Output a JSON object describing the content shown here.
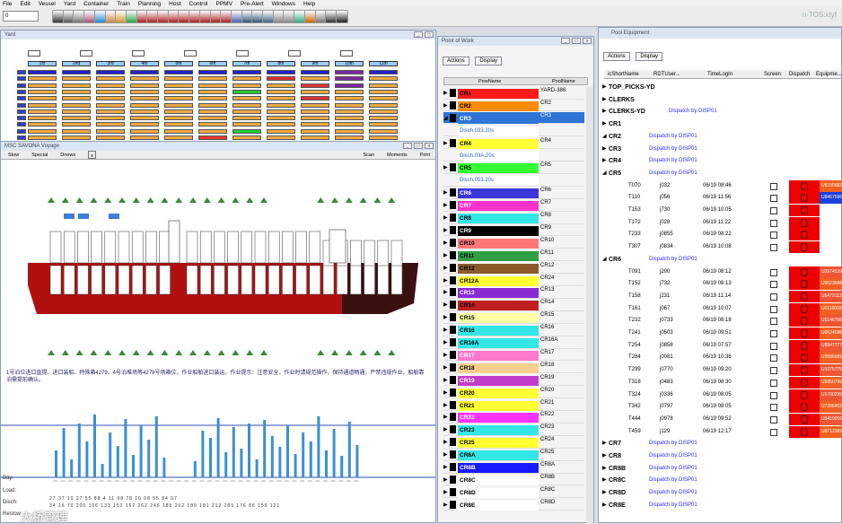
{
  "menu": [
    "File",
    "Edit",
    "Vessel",
    "Yard",
    "Container",
    "Train",
    "Planning",
    "Host",
    "Control",
    "PPMV",
    "Pre-Alert",
    "Windows",
    "Help"
  ],
  "toolbar": {
    "combo_value": "0",
    "app_title": "n-TOS:xtyf"
  },
  "yard": {
    "title": "Yard",
    "blocks": [
      "1st",
      "2nd",
      "3rd",
      "4th",
      "5th",
      "6th",
      "7th",
      "8th",
      "9th",
      "10th",
      "11th"
    ]
  },
  "vessel": {
    "title": "MSC SAVONA  Voyage",
    "tabs": [
      "Stow",
      "Special",
      "Dnews"
    ],
    "right_tabs": [
      "Scan",
      "Moments",
      "Print"
    ],
    "note": "1号泊位进口直提、进口装船、特殊箱4279、4号泊堆场等4279号场箱位，作业船舶进口装运。作业提示：注意安全，作业时请规范操作，保持通道畅通，严禁违规作业，船舶靠泊需提前确认。",
    "row_labels": [
      "Bay:",
      "Load:",
      "Disch:",
      "Restow:"
    ],
    "load_nums": "27 37 10 27 55 88 4 11 98 78 16 08 55 84 07",
    "disch_nums": "34 16 70 200 106 133 152 162 262 246 186 262 189 181 212 289 176 86 159 121",
    "watermark": "大桥管理"
  },
  "pow": {
    "title": "Point of Work",
    "actions": "Actions",
    "display": "Display",
    "col_pow": "PowName",
    "col_pool": "PoolName",
    "rows": [
      {
        "name": "CR1",
        "color": "#ff1a1a",
        "pool": "YARD-386",
        "text": "#000"
      },
      {
        "name": "CR2",
        "color": "#ff8c00",
        "pool": "CR2",
        "text": "#000"
      },
      {
        "name": "CR3",
        "color": "#2f75d6",
        "pool": "CR3",
        "text": "#fff",
        "selected": true
      },
      {
        "name": "Disch.033.20s",
        "color": "#fff",
        "pool": "",
        "text": "#2a62c9",
        "sub": true
      },
      {
        "name": "CR4",
        "color": "#ffff33",
        "pool": "CR4",
        "text": "#000"
      },
      {
        "name": "Disch.03A.20s",
        "color": "#fff",
        "pool": "",
        "text": "#2a62c9",
        "sub": true
      },
      {
        "name": "CR5",
        "color": "#33ff33",
        "pool": "CR5",
        "text": "#000"
      },
      {
        "name": "Disch.053.20s",
        "color": "#fff",
        "pool": "",
        "text": "#2a62c9",
        "sub": true
      },
      {
        "name": "CR6",
        "color": "#3a37d8",
        "pool": "CR6",
        "text": "#fff"
      },
      {
        "name": "CR7",
        "color": "#ff33cc",
        "pool": "CR7",
        "text": "#fff"
      },
      {
        "name": "CR8",
        "color": "#33e6e6",
        "pool": "CR8",
        "text": "#000"
      },
      {
        "name": "CR9",
        "color": "#000000",
        "pool": "CR9",
        "text": "#fff"
      },
      {
        "name": "CR10",
        "color": "#ff7777",
        "pool": "CR10",
        "text": "#000"
      },
      {
        "name": "CR11",
        "color": "#2ea043",
        "pool": "CR11",
        "text": "#000"
      },
      {
        "name": "CR12",
        "color": "#8a5a2b",
        "pool": "CR12",
        "text": "#000"
      },
      {
        "name": "CR12A",
        "color": "#ffff33",
        "pool": "CR24",
        "text": "#000"
      },
      {
        "name": "CR13",
        "color": "#8a2bd6",
        "pool": "CR13",
        "text": "#fff"
      },
      {
        "name": "CR14",
        "color": "#c02020",
        "pool": "CR14",
        "text": "#000"
      },
      {
        "name": "CR15",
        "color": "#ffffa8",
        "pool": "CR15",
        "text": "#000"
      },
      {
        "name": "CR16",
        "color": "#33e6e6",
        "pool": "CR16",
        "text": "#000"
      },
      {
        "name": "CR16A",
        "color": "#33e6e6",
        "pool": "CR16A",
        "text": "#000"
      },
      {
        "name": "CR17",
        "color": "#ff77cc",
        "pool": "CR17",
        "text": "#fff"
      },
      {
        "name": "CR18",
        "color": "#f6d08c",
        "pool": "CR18",
        "text": "#000"
      },
      {
        "name": "CR19",
        "color": "#c33cc9",
        "pool": "CR19",
        "text": "#fff"
      },
      {
        "name": "CR20",
        "color": "#ffff33",
        "pool": "CR20",
        "text": "#000"
      },
      {
        "name": "CR21",
        "color": "#ffff33",
        "pool": "CR21",
        "text": "#000"
      },
      {
        "name": "CR22",
        "color": "#ff33ff",
        "pool": "CR22",
        "text": "#fff"
      },
      {
        "name": "CR23",
        "color": "#33e6e6",
        "pool": "CR23",
        "text": "#000"
      },
      {
        "name": "CR25",
        "color": "#ffff33",
        "pool": "CR24",
        "text": "#000"
      },
      {
        "name": "CR8A",
        "color": "#33e6e6",
        "pool": "CR25",
        "text": "#000"
      },
      {
        "name": "CR8B",
        "color": "#1a1aff",
        "pool": "CR8A",
        "text": "#fff"
      },
      {
        "name": "CR8C",
        "color": "#fff",
        "pool": "CR8B",
        "text": "#000"
      },
      {
        "name": "CR8D",
        "color": "#fff",
        "pool": "CR8C",
        "text": "#000"
      },
      {
        "name": "CR8E",
        "color": "#fff",
        "pool": "CR8D",
        "text": "#000"
      }
    ]
  },
  "pool": {
    "title": "Pool Equipment",
    "actions": "Actions",
    "display": "Display",
    "headers": [
      "icShortName",
      "RDTUser...",
      "TimeLogIn",
      "Screen",
      "Dispatch",
      "Equipme..."
    ],
    "dispatch_label": "Dispatch by DISP01",
    "rows": [
      {
        "t": "group",
        "name": "TOP_PICKS-YD"
      },
      {
        "t": "group",
        "name": "CLERKS"
      },
      {
        "t": "group",
        "name": "CLERKS-YD",
        "disp": true
      },
      {
        "t": "group",
        "name": "CR1"
      },
      {
        "t": "group",
        "name": "CR2",
        "disp": true,
        "open": true
      },
      {
        "t": "group",
        "name": "CR3",
        "disp": true
      },
      {
        "t": "group",
        "name": "CR4",
        "disp": true
      },
      {
        "t": "group",
        "name": "CR5",
        "disp": true,
        "open": true
      },
      {
        "t": "eq",
        "name": "T070",
        "user": "j032",
        "time": "06/19 08:46",
        "status": "U5155683"
      },
      {
        "t": "eq",
        "name": "T110",
        "user": "j056",
        "time": "06/19 11:56",
        "status": "U8467596"
      },
      {
        "t": "eq",
        "name": "T153",
        "user": "j730",
        "time": "06/19 10:05"
      },
      {
        "t": "eq",
        "name": "T172",
        "user": "j028",
        "time": "06/19 11:22"
      },
      {
        "t": "eq",
        "name": "T233",
        "user": "j0855",
        "time": "06/19 08:22"
      },
      {
        "t": "eq",
        "name": "T307",
        "user": "j0834",
        "time": "06/19 10:08"
      },
      {
        "t": "group",
        "name": "CR6",
        "disp": true,
        "open": true
      },
      {
        "t": "eq",
        "name": "T091",
        "user": "j200",
        "time": "06/19 08:12",
        "status": "U2974539"
      },
      {
        "t": "eq",
        "name": "T152",
        "user": "j732",
        "time": "06/19 08:13",
        "status": "U0023588"
      },
      {
        "t": "eq",
        "name": "T158",
        "user": "j231",
        "time": "06/19 11:14",
        "status": "U5479113"
      },
      {
        "t": "eq",
        "name": "T161",
        "user": "j067",
        "time": "06/19 10:07",
        "status": "U0110003"
      },
      {
        "t": "eq",
        "name": "T232",
        "user": "j0733",
        "time": "06/19 08:18",
        "status": "U5146758"
      },
      {
        "t": "eq",
        "name": "T241",
        "user": "j0503",
        "time": "06/19 09:51",
        "status": "U0624588"
      },
      {
        "t": "eq",
        "name": "T254",
        "user": "j0858",
        "time": "06/19 07:57",
        "status": "U8847777"
      },
      {
        "t": "eq",
        "name": "T284",
        "user": "j0081",
        "time": "06/19 10:36",
        "status": "U3686689"
      },
      {
        "t": "eq",
        "name": "T299",
        "user": "j0770",
        "time": "06/19 09:20",
        "status": "U1075775"
      },
      {
        "t": "eq",
        "name": "T318",
        "user": "j0483",
        "time": "06/19 08:30",
        "status": "U5850799"
      },
      {
        "t": "eq",
        "name": "T324",
        "user": "j0336",
        "time": "06/19 08:05",
        "status": "U1700299"
      },
      {
        "t": "eq",
        "name": "T342",
        "user": "j0797",
        "time": "06/19 08:05",
        "status": "U7286453"
      },
      {
        "t": "eq",
        "name": "T444",
        "user": "j0978",
        "time": "06/19 09:52",
        "status": "U8419055"
      },
      {
        "t": "eq",
        "name": "T459",
        "user": "j129",
        "time": "06/19 12:17",
        "status": "U8712389"
      },
      {
        "t": "group",
        "name": "CR7",
        "disp": true
      },
      {
        "t": "group",
        "name": "CR8",
        "disp": true
      },
      {
        "t": "group",
        "name": "CR8B",
        "disp": true
      },
      {
        "t": "group",
        "name": "CR8C",
        "disp": true
      },
      {
        "t": "group",
        "name": "CR8D",
        "disp": true
      },
      {
        "t": "group",
        "name": "CR8E",
        "disp": true
      }
    ]
  },
  "colors": {
    "hull": "#b01010",
    "bar": "#3b8fd6",
    "select": "#2f75d6",
    "red": "#e00000"
  }
}
